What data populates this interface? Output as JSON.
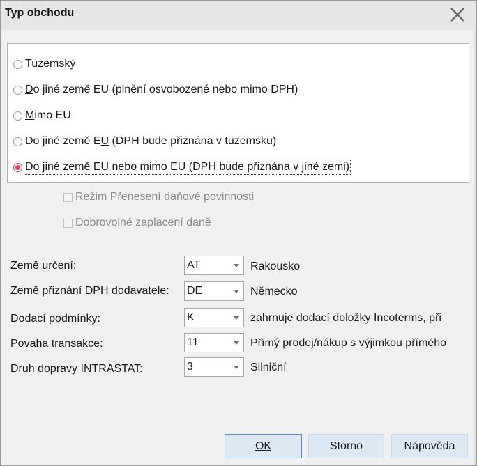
{
  "window": {
    "title": "Typ obchodu"
  },
  "trade_type": {
    "options": [
      {
        "label": "Tuzemský",
        "mnemonic_index": 0,
        "checked": false
      },
      {
        "label": "Do jiné země EU (plnění osvobozené nebo mimo DPH)",
        "mnemonic_index": 0,
        "checked": false
      },
      {
        "label": "Mimo EU",
        "mnemonic_index": 0,
        "checked": false
      },
      {
        "label": "Do jiné země EU (DPH bude přiznána v tuzemsku)",
        "mnemonic_index": 14,
        "checked": false
      },
      {
        "label": "Do jiné země EU nebo mimo EU (DPH bude přiznána v jiné zemi)",
        "mnemonic_index": 30,
        "checked": true
      }
    ],
    "selected_color": "#e83e5c"
  },
  "checkboxes": {
    "reverse_charge": {
      "label": "Režim Přenesení daňové povinnosti",
      "checked": false,
      "enabled": false
    },
    "voluntary_tax": {
      "label": "Dobrovolné zaplacení daně",
      "checked": false,
      "enabled": false
    }
  },
  "fields": [
    {
      "label": "Země určení:",
      "value": "AT",
      "description": "Rakousko"
    },
    {
      "label": "Země přiznání DPH dodavatele:",
      "value": "DE",
      "description": "Německo"
    },
    {
      "label": "Dodací podmínky:",
      "value": "K",
      "description": "zahrnuje dodací doložky Incoterms, při"
    },
    {
      "label": "Povaha transakce:",
      "value": "11",
      "description": "Přímý prodej/nákup s výjimkou přímého"
    },
    {
      "label": "Druh dopravy INTRASTAT:",
      "value": "3",
      "description": "Silniční"
    }
  ],
  "buttons": {
    "ok": "OK",
    "cancel": "Storno",
    "help": "Nápověda"
  },
  "icons": {
    "close": "close-x-icon",
    "dropdown": "chevron-down-icon"
  }
}
